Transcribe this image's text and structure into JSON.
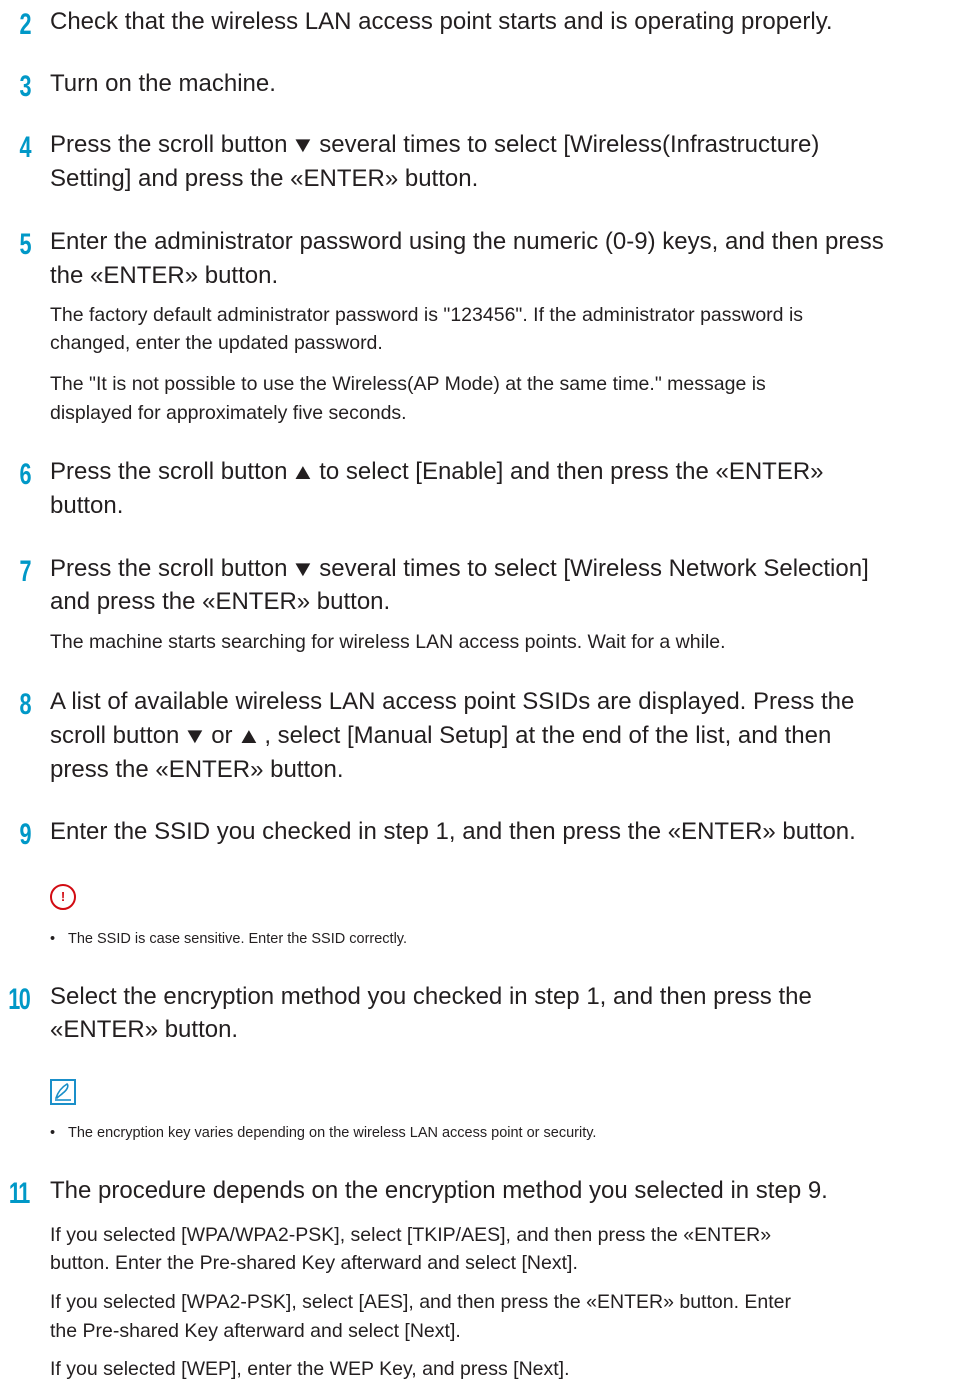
{
  "steps": [
    {
      "number": "2",
      "lines": [
        "Check that the wireless LAN access point starts and is operating properly."
      ]
    },
    {
      "number": "3",
      "lines": [
        "Turn on the machine."
      ]
    },
    {
      "number": "4",
      "l1a": "Press the scroll button",
      "l1b": "several times to select [Wireless(Infrastructure)",
      "l2": "Setting] and press the «ENTER» button."
    },
    {
      "number": "5",
      "lines": [
        "Enter the administrator password using the numeric (0-9) keys, and then press",
        "the «ENTER» button."
      ],
      "body": [
        "The factory default administrator password is \"123456\". If the administrator password is",
        "changed, enter the updated password.",
        "The \"It is not possible to use the Wireless(AP Mode) at the same time.\" message is",
        "displayed for approximately five seconds."
      ]
    },
    {
      "number": "6",
      "l1a": "Press the scroll button",
      "l1b": "to select [Enable] and then press the «ENTER»",
      "l2": "button."
    },
    {
      "number": "7",
      "l1a": "Press the scroll button",
      "l1b": "several times to select [Wireless Network Selection]",
      "l2": "and press the «ENTER» button.",
      "body": [
        "The machine starts searching for wireless LAN access points. Wait for a while."
      ]
    },
    {
      "number": "8",
      "l1": "A list of available wireless LAN access point SSIDs are displayed. Press the",
      "l2a": "scroll button",
      "l2b": "or",
      "l2c": ", select [Manual Setup] at the end of the list, and then",
      "l3": "press the «ENTER» button."
    },
    {
      "number": "9",
      "lines": [
        "Enter the SSID you checked in step 1, and then press the «ENTER» button."
      ],
      "note_icon": "!",
      "note": "The SSID is case sensitive. Enter the SSID correctly."
    },
    {
      "number": "10",
      "lines": [
        "Select the encryption method you checked in step 1, and then press the",
        "«ENTER» button."
      ],
      "memo": "The encryption key varies depending on the wireless LAN access point or security."
    },
    {
      "number": "11",
      "lines": [
        "The procedure depends on the encryption method you selected in step 9."
      ],
      "body": [
        "If you selected [WPA/WPA2-PSK], select [TKIP/AES], and then press the «ENTER»",
        "button. Enter the Pre-shared Key afterward and select [Next].",
        "If you selected [WPA2-PSK], select [AES], and then press the «ENTER» button. Enter",
        "the Pre-shared Key afterward and select [Next].",
        "If you selected [WEP], enter the WEP Key, and press [Next]."
      ]
    }
  ],
  "icons": {
    "down": "▼",
    "up": "▲",
    "note_icon_name": "important-icon",
    "memo_icon_name": "memo-icon"
  },
  "colors": {
    "step_number": "#0098c7",
    "important": "#d20b12",
    "memo": "#1a8fc9"
  }
}
